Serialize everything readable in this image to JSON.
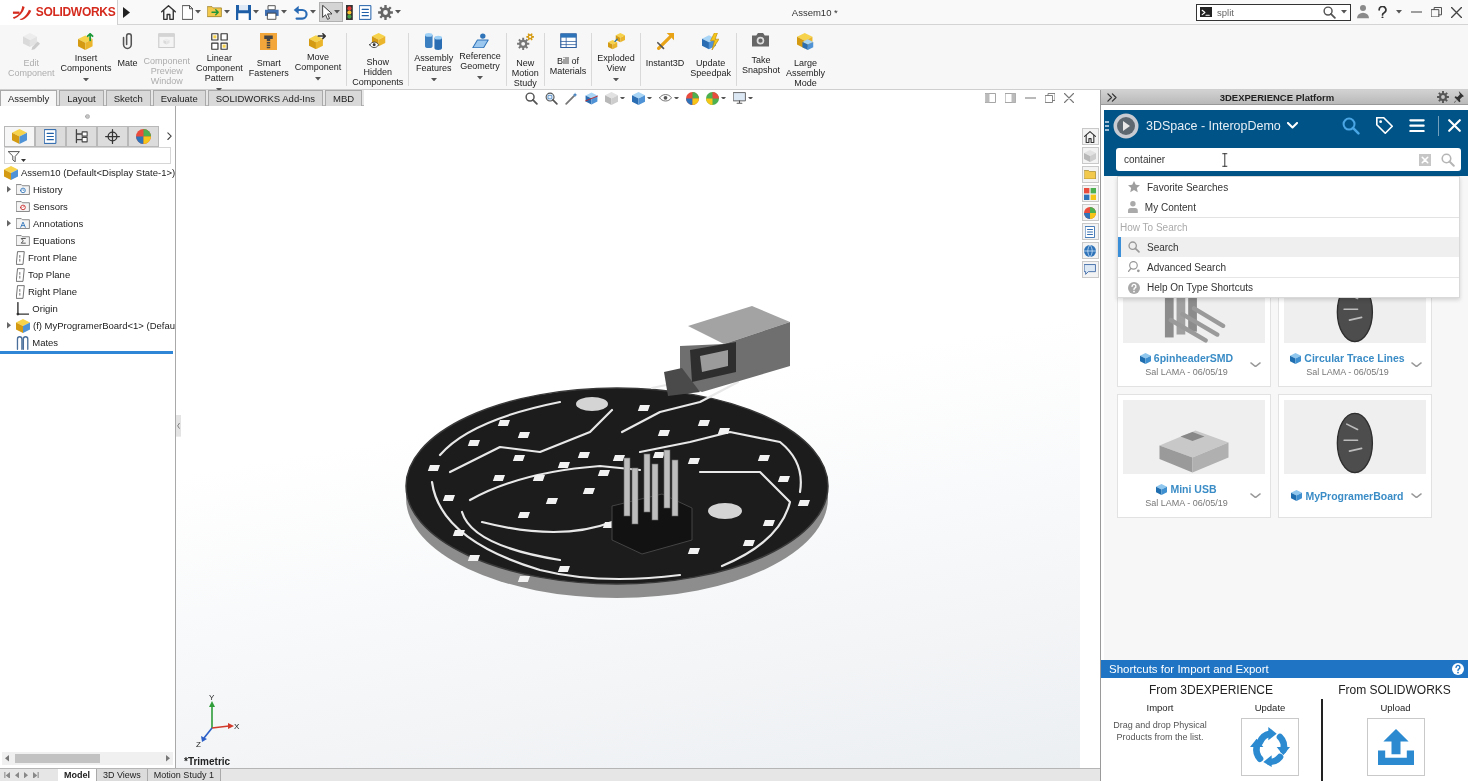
{
  "title_bar": {
    "logo_text": "SOLIDWORKS",
    "quick_access": [
      {
        "kind": "home",
        "dropdown": false,
        "selected": false
      },
      {
        "kind": "new",
        "dropdown": true,
        "selected": false
      },
      {
        "kind": "open",
        "dropdown": true,
        "selected": false
      },
      {
        "kind": "save",
        "dropdown": true,
        "selected": false
      },
      {
        "kind": "print",
        "dropdown": true,
        "selected": false
      },
      {
        "kind": "undo",
        "dropdown": true,
        "selected": false
      },
      {
        "kind": "select",
        "dropdown": true,
        "selected": true
      },
      {
        "kind": "rebuild",
        "dropdown": false,
        "selected": false
      },
      {
        "kind": "properties",
        "dropdown": false,
        "selected": false
      },
      {
        "kind": "options",
        "dropdown": true,
        "selected": false
      }
    ],
    "document_title": "Assem10 *",
    "search": {
      "value": "split"
    }
  },
  "ribbon": {
    "groups": [
      {
        "buttons": [
          {
            "label": "Edit Component",
            "disabled": true,
            "dropdown": false
          },
          {
            "label": "Insert Components",
            "disabled": false,
            "dropdown": true
          },
          {
            "label": "Mate",
            "disabled": false,
            "dropdown": false
          },
          {
            "label": "Component Preview Window",
            "disabled": true,
            "dropdown": false
          },
          {
            "label": "Linear Component Pattern",
            "disabled": false,
            "dropdown": true
          },
          {
            "label": "Smart Fasteners",
            "disabled": false,
            "dropdown": false
          },
          {
            "label": "Move Component",
            "disabled": false,
            "dropdown": true
          }
        ]
      },
      {
        "buttons": [
          {
            "label": "Show Hidden Components",
            "disabled": false,
            "dropdown": false
          }
        ]
      },
      {
        "buttons": [
          {
            "label": "Assembly Features",
            "disabled": false,
            "dropdown": true
          },
          {
            "label": "Reference Geometry",
            "disabled": false,
            "dropdown": true
          }
        ]
      },
      {
        "buttons": [
          {
            "label": "New Motion Study",
            "disabled": false,
            "dropdown": false
          }
        ]
      },
      {
        "buttons": [
          {
            "label": "Bill of Materials",
            "disabled": false,
            "dropdown": false
          }
        ]
      },
      {
        "buttons": [
          {
            "label": "Exploded View",
            "disabled": false,
            "dropdown": true
          }
        ]
      },
      {
        "buttons": [
          {
            "label": "Instant3D",
            "disabled": false,
            "dropdown": false
          },
          {
            "label": "Update Speedpak",
            "disabled": false,
            "dropdown": false
          }
        ]
      },
      {
        "buttons": [
          {
            "label": "Take Snapshot",
            "disabled": false,
            "dropdown": false
          },
          {
            "label": "Large Assembly Mode",
            "disabled": false,
            "dropdown": false
          }
        ]
      }
    ]
  },
  "command_tabs": [
    {
      "label": "Assembly",
      "selected": true
    },
    {
      "label": "Layout",
      "selected": false
    },
    {
      "label": "Sketch",
      "selected": false
    },
    {
      "label": "Evaluate",
      "selected": false
    },
    {
      "label": "SOLIDWORKS Add-Ins",
      "selected": false
    },
    {
      "label": "MBD",
      "selected": false
    }
  ],
  "feature_manager": {
    "panel_tabs": [
      {
        "selected": true
      },
      {
        "selected": false
      },
      {
        "selected": false
      },
      {
        "selected": false
      },
      {
        "selected": false
      }
    ],
    "tree": {
      "label": "Assem10 (Default<Display State-1>)",
      "kind": "assembly",
      "children": [
        {
          "label": "History",
          "kind": "history",
          "expanded": false
        },
        {
          "label": "Sensors",
          "kind": "sensors"
        },
        {
          "label": "Annotations",
          "kind": "annotations",
          "expanded": false
        },
        {
          "label": "Equations",
          "kind": "equations"
        },
        {
          "label": "Front Plane",
          "kind": "plane"
        },
        {
          "label": "Top Plane",
          "kind": "plane"
        },
        {
          "label": "Right Plane",
          "kind": "plane"
        },
        {
          "label": "Origin",
          "kind": "origin"
        },
        {
          "label": "(f) MyProgramerBoard<1> (Defau",
          "kind": "component",
          "expanded": false
        },
        {
          "label": "Mates",
          "kind": "mates"
        }
      ]
    }
  },
  "viewport": {
    "axes": [
      "Y",
      "X",
      "Z"
    ],
    "view_name": "*Trimetric"
  },
  "sheet_tabs": [
    {
      "label": "Model",
      "selected": true
    },
    {
      "label": "3D Views",
      "selected": false
    },
    {
      "label": "Motion Study 1",
      "selected": false
    }
  ],
  "task_pane": {
    "title": "3DEXPERIENCE Platform",
    "widget": {
      "title": "3DSpace - InteropDemo",
      "search": {
        "value": "container"
      },
      "suggestions": [
        {
          "kind": "star",
          "label": "Favorite Searches",
          "selected": false
        },
        {
          "kind": "person",
          "label": "My Content",
          "selected": false
        }
      ],
      "help_heading": "How To Search",
      "help_items": [
        {
          "kind": "search",
          "label": "Search",
          "selected": true
        },
        {
          "kind": "advanced",
          "label": "Advanced Search",
          "selected": false
        },
        {
          "kind": "help",
          "label": "Help On Type Shortcuts",
          "selected": false
        }
      ],
      "cards": [
        {
          "kind": "pins",
          "title": "6pinheaderSMD",
          "meta": "Sal LAMA - 06/05/19"
        },
        {
          "kind": "disc",
          "title": "Circular Trace Lines",
          "meta": "Sal LAMA - 06/05/19"
        },
        {
          "kind": "connector",
          "title": "Mini USB",
          "meta": "Sal LAMA - 06/05/19"
        },
        {
          "kind": "disc",
          "title": "MyProgramerBoard"
        }
      ]
    },
    "shortcuts": {
      "title": "Shortcuts for Import and Export",
      "columns": [
        {
          "heading": "From 3DEXPERIENCE",
          "actions": [
            {
              "kind": "text",
              "label": "Import",
              "description": "Drag and drop Physical Products from the list."
            },
            {
              "kind": "update",
              "label": "Update"
            }
          ]
        },
        {
          "heading": "From SOLIDWORKS",
          "actions": [
            {
              "kind": "upload",
              "label": "Upload"
            }
          ]
        }
      ]
    }
  }
}
